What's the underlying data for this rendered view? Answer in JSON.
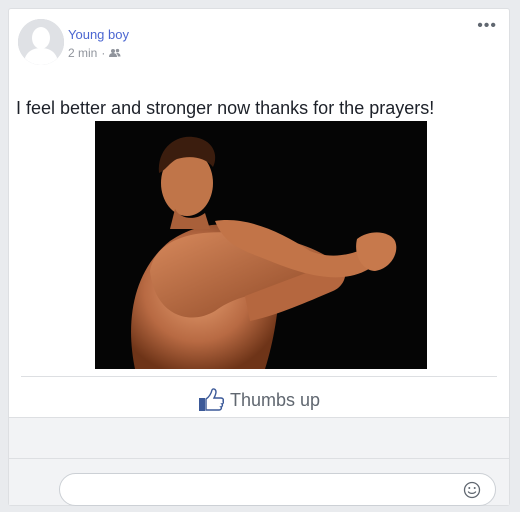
{
  "post": {
    "author": "Young boy",
    "time": "2 min",
    "privacy_icon": "friends-icon",
    "more_icon": "more-options-icon",
    "more_label": "•••",
    "text": "I feel better and stronger now thanks for the prayers!",
    "photo_icon": "bodybuilder-photo"
  },
  "actions": {
    "like_label": "Thumbs up",
    "like_icon": "thumbs-up-icon"
  },
  "comment": {
    "placeholder": "",
    "emoji_icon": "smiley-icon"
  },
  "colors": {
    "author": "#4b66d1",
    "like_icon": "#3b5998",
    "background": "#e9ebee"
  }
}
